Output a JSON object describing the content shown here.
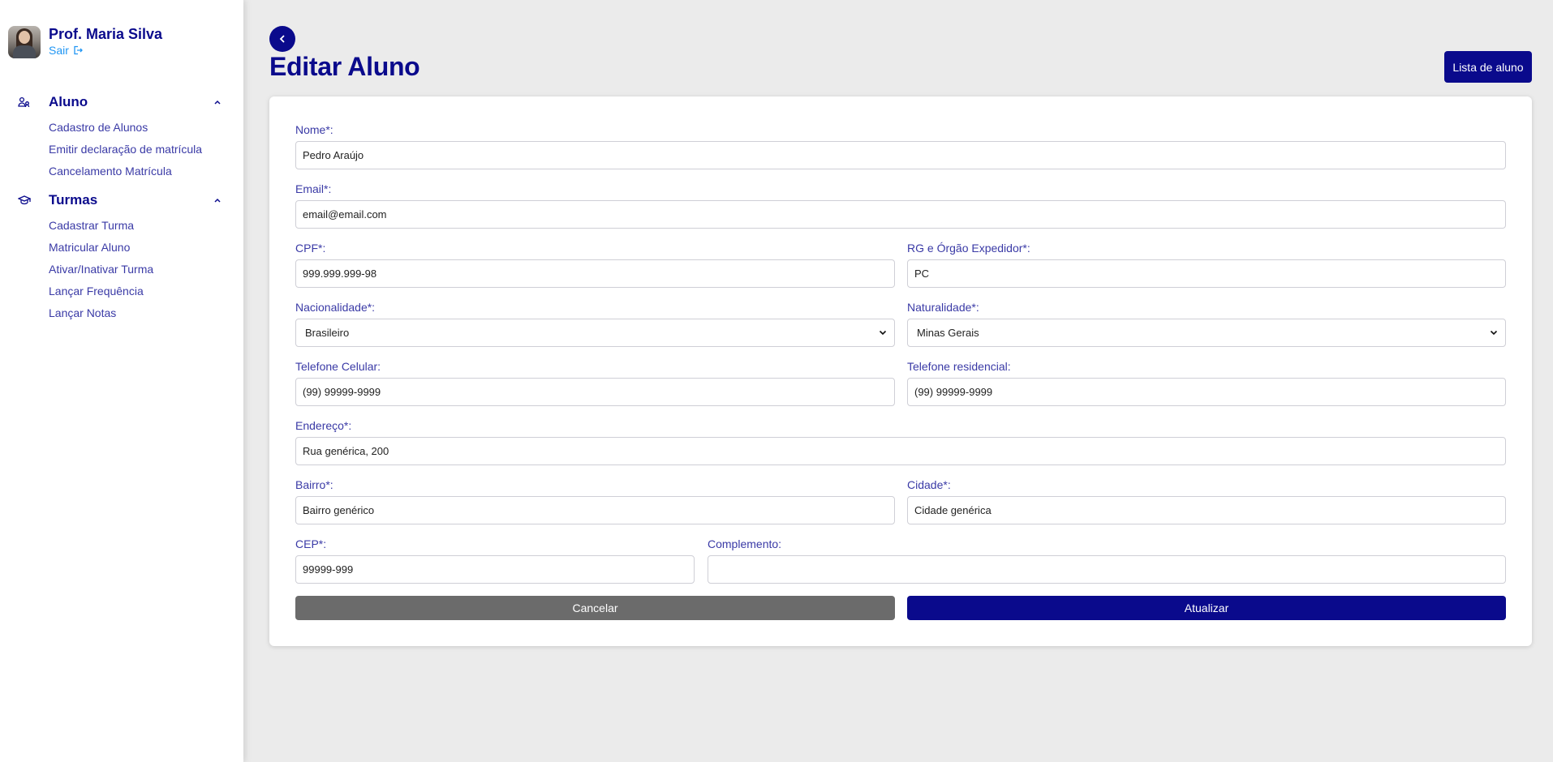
{
  "profile": {
    "name": "Prof. Maria Silva",
    "logout_label": "Sair"
  },
  "sidebar": {
    "sections": [
      {
        "title": "Aluno",
        "icon": "students-icon",
        "items": [
          {
            "label": "Cadastro de Alunos"
          },
          {
            "label": "Emitir declaração de matrícula"
          },
          {
            "label": "Cancelamento Matrícula"
          }
        ]
      },
      {
        "title": "Turmas",
        "icon": "graduation-cap-icon",
        "items": [
          {
            "label": "Cadastrar Turma"
          },
          {
            "label": "Matricular Aluno"
          },
          {
            "label": "Ativar/Inativar Turma"
          },
          {
            "label": "Lançar Frequência"
          },
          {
            "label": "Lançar Notas"
          }
        ]
      }
    ]
  },
  "header": {
    "title": "Editar Aluno",
    "list_button_label": "Lista de aluno"
  },
  "form": {
    "nome": {
      "label": "Nome*:",
      "value": "Pedro Araújo"
    },
    "email": {
      "label": "Email*:",
      "value": "email@email.com"
    },
    "cpf": {
      "label": "CPF*:",
      "value": "999.999.999-98"
    },
    "rg": {
      "label": "RG e Órgão Expedidor*:",
      "value": "PC"
    },
    "nacionalidade": {
      "label": "Nacionalidade*:",
      "value": "Brasileiro"
    },
    "naturalidade": {
      "label": "Naturalidade*:",
      "value": "Minas Gerais"
    },
    "telefone_celular": {
      "label": "Telefone Celular:",
      "value": "(99) 99999-9999"
    },
    "telefone_residencial": {
      "label": "Telefone residencial:",
      "value": "(99) 99999-9999"
    },
    "endereco": {
      "label": "Endereço*:",
      "value": "Rua genérica, 200"
    },
    "bairro": {
      "label": "Bairro*:",
      "value": "Bairro genérico"
    },
    "cidade": {
      "label": "Cidade*:",
      "value": "Cidade genérica"
    },
    "cep": {
      "label": "CEP*:",
      "value": "99999-999"
    },
    "complemento": {
      "label": "Complemento:",
      "value": ""
    },
    "cancel_label": "Cancelar",
    "update_label": "Atualizar"
  },
  "colors": {
    "primary": "#0a0a8c",
    "link": "#2196f3",
    "label": "#3a3aa6",
    "cancel": "#6b6b6b",
    "background": "#ebebeb"
  }
}
